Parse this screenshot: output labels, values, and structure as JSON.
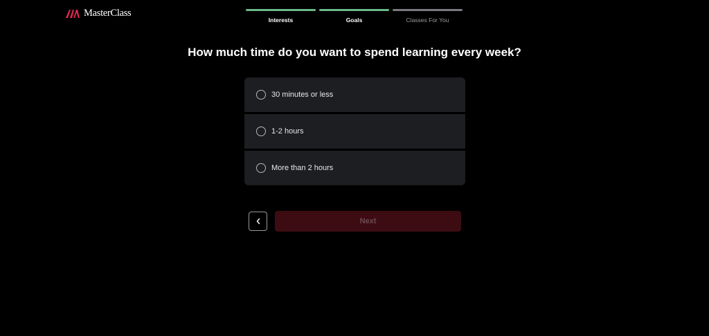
{
  "brand": {
    "name": "MasterClass",
    "accent": "#e32652"
  },
  "progress": {
    "steps": [
      {
        "label": "Interests",
        "done": true
      },
      {
        "label": "Goals",
        "done": true
      },
      {
        "label": "Classes For You",
        "done": false
      }
    ],
    "done_color": "#6cba8a"
  },
  "question": "How much time do you want to spend learning every week?",
  "options": [
    {
      "label": "30 minutes or less",
      "selected": false
    },
    {
      "label": "1-2 hours",
      "selected": false
    },
    {
      "label": "More than 2 hours",
      "selected": false
    }
  ],
  "nav": {
    "back_icon": "chevron-left-icon",
    "next_label": "Next",
    "next_disabled": true
  }
}
